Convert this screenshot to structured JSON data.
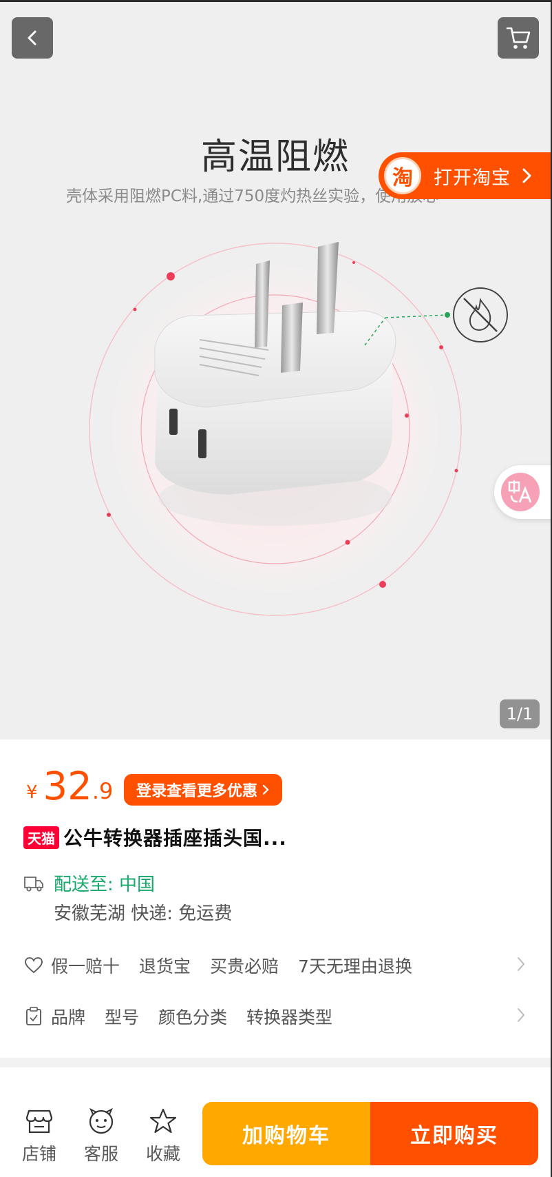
{
  "hero": {
    "title": "高温阻燃",
    "subtitle": "壳体采用阻燃PC料,通过750度灼热丝实验，使用放心",
    "image_counter": "1/1",
    "open_app_label": "打开淘宝",
    "taobao_logo_glyph": "淘"
  },
  "product": {
    "currency_symbol": "¥",
    "price_integer": "32",
    "price_decimal": ".9",
    "coupon_label": "登录查看更多优惠",
    "store_badge": "天猫",
    "title": "公牛转换器插座插头国..."
  },
  "shipping": {
    "destination": "配送至: 中国",
    "details": "安徽芜湖  快递: 免运费"
  },
  "services": [
    "假一赔十",
    "退货宝",
    "买贵必赔",
    "7天无理由退换"
  ],
  "attributes": [
    "品牌",
    "型号",
    "颜色分类",
    "转换器类型"
  ],
  "bottom": {
    "store_label": "店铺",
    "service_label": "客服",
    "favorite_label": "收藏",
    "add_to_cart_label": "加购物车",
    "buy_now_label": "立即购买"
  },
  "colors": {
    "accent_orange": "#ff5000",
    "cart_yellow": "#ffa800",
    "tmall_red": "#ff0036",
    "shipping_green": "#17a86b"
  },
  "icons": [
    "back-arrow-icon",
    "cart-icon",
    "taobao-logo-icon",
    "chevron-right-icon",
    "translate-icon",
    "truck-icon",
    "heart-icon",
    "clipboard-icon",
    "store-icon",
    "service-face-icon",
    "star-icon",
    "no-fire-icon"
  ]
}
